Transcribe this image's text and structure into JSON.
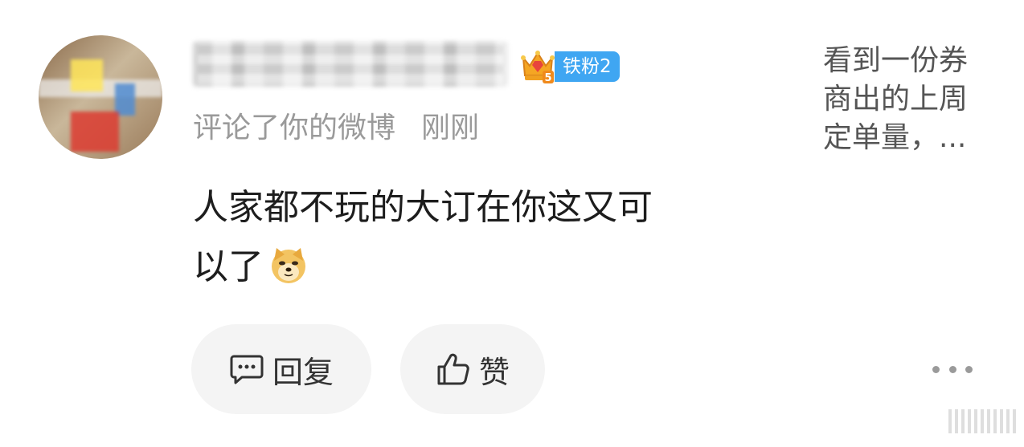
{
  "user": {
    "name": "",
    "fan_badge": "铁粉2",
    "crown_level": "5"
  },
  "meta": {
    "action": "评论了你的微博",
    "time": "刚刚"
  },
  "comment": {
    "line1": "人家都不玩的大订在你这又可",
    "line2": "以了",
    "emoji": "doge-emoji"
  },
  "quoted_post": {
    "line1": "看到一份券",
    "line2": "商出的上周",
    "line3": "定单量，..."
  },
  "actions": {
    "reply_label": "回复",
    "like_label": "赞"
  },
  "colors": {
    "badge_blue": "#3fa6f2",
    "meta_gray": "#9a9a9a",
    "button_bg": "#f4f4f4"
  }
}
